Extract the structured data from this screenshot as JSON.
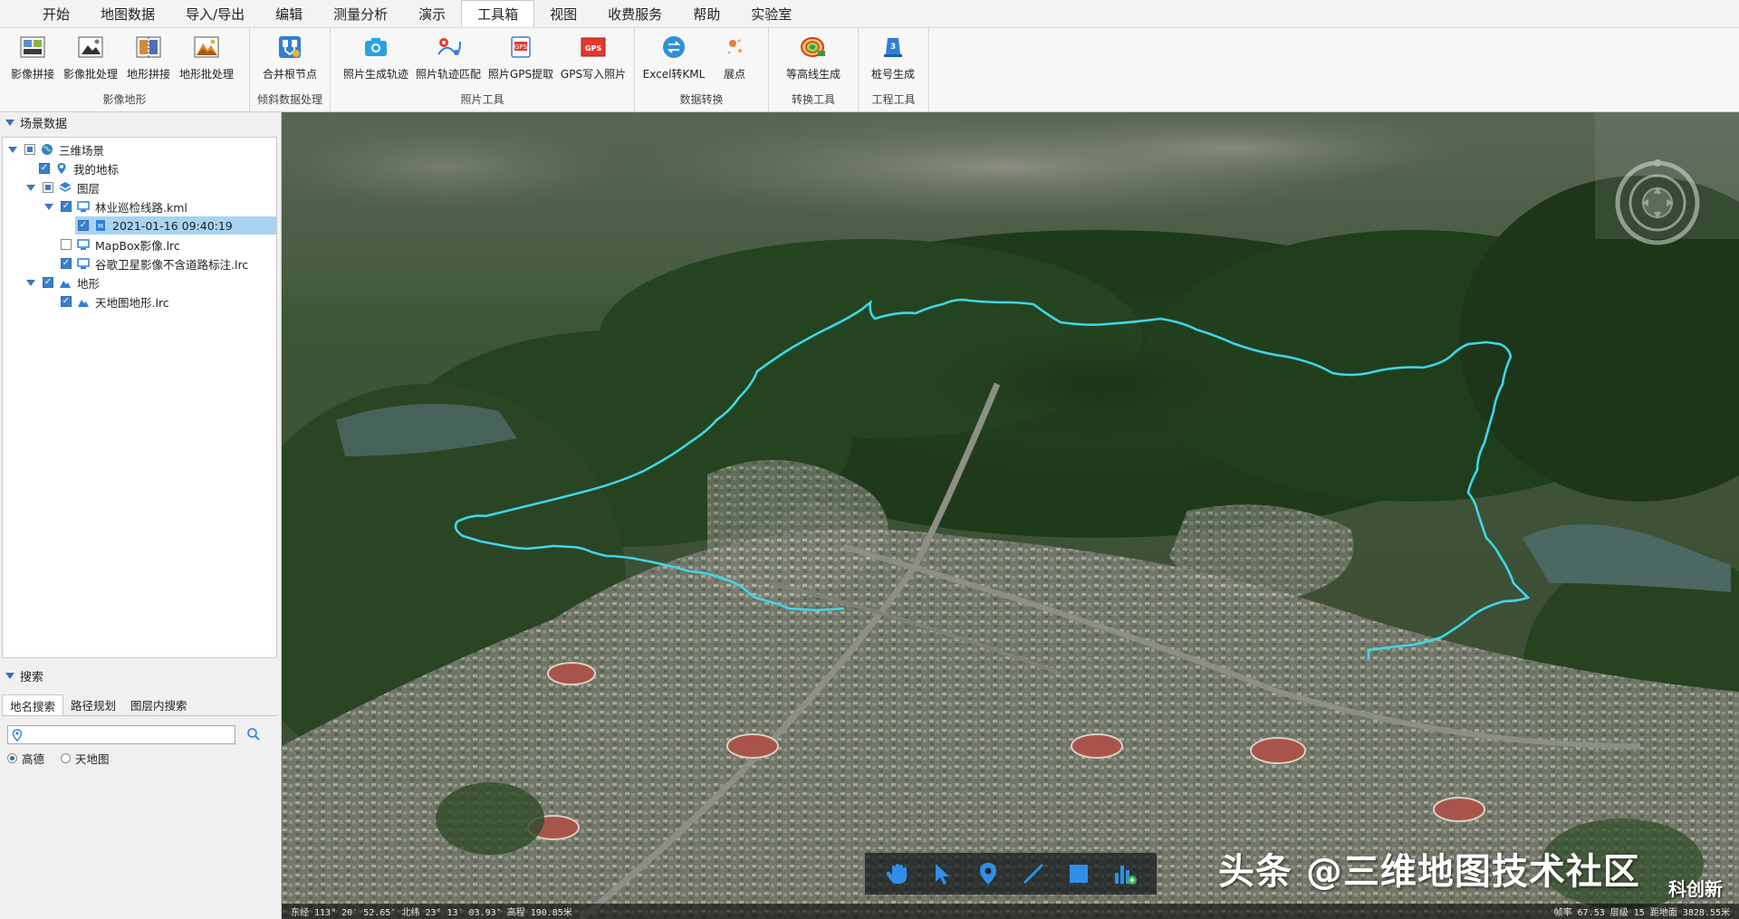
{
  "menu": {
    "tabs": [
      "开始",
      "地图数据",
      "导入/导出",
      "编辑",
      "测量分析",
      "演示",
      "工具箱",
      "视图",
      "收费服务",
      "帮助",
      "实验室"
    ],
    "active_index": 6
  },
  "ribbon": {
    "groups": [
      {
        "label": "影像地形",
        "tools": [
          {
            "label": "影像拼接",
            "icon": "image-mosaic-icon"
          },
          {
            "label": "影像批处理",
            "icon": "image-batch-icon"
          },
          {
            "label": "地形拼接",
            "icon": "terrain-mosaic-icon"
          },
          {
            "label": "地形批处理",
            "icon": "terrain-batch-icon"
          }
        ]
      },
      {
        "label": "倾斜数据处理",
        "tools": [
          {
            "label": "合并根节点",
            "icon": "merge-root-node-icon"
          }
        ]
      },
      {
        "label": "照片工具",
        "tools": [
          {
            "label": "照片生成轨迹",
            "icon": "photo-track-icon"
          },
          {
            "label": "照片轨迹匹配",
            "icon": "photo-track-match-icon"
          },
          {
            "label": "照片GPS提取",
            "icon": "gps-extract-icon"
          },
          {
            "label": "GPS写入照片",
            "icon": "gps-write-icon"
          }
        ]
      },
      {
        "label": "数据转换",
        "tools": [
          {
            "label": "Excel转KML",
            "icon": "excel-kml-icon"
          },
          {
            "label": "展点",
            "icon": "scatter-points-icon"
          }
        ]
      },
      {
        "label": "转换工具",
        "tools": [
          {
            "label": "等高线生成",
            "icon": "contour-icon"
          }
        ]
      },
      {
        "label": "工程工具",
        "tools": [
          {
            "label": "桩号生成",
            "icon": "stake-number-icon"
          }
        ]
      }
    ]
  },
  "scene_panel": {
    "title": "场景数据",
    "tree": {
      "root": "三维场景",
      "my_marks": "我的地标",
      "layers": "图层",
      "kml": "林业巡检线路.kml",
      "kml_child": "2021-01-16 09:40:19",
      "mapbox": "MapBox影像.lrc",
      "google": "谷歌卫星影像不含道路标注.lrc",
      "terrain": "地形",
      "terrain_child": "天地图地形.lrc"
    }
  },
  "search_panel": {
    "title": "搜索",
    "tabs": [
      "地名搜索",
      "路径规划",
      "图层内搜索"
    ],
    "input_value": "",
    "input_placeholder": "",
    "providers": [
      "高德",
      "天地图"
    ],
    "selected_provider": "高德"
  },
  "map": {
    "watermark": "头条 @三维地图技术社区",
    "corner_mark": "科创新",
    "status_left": "东经 113° 20′ 52.65″  北纬 23° 13′ 03.93″  高程 190.85米",
    "status_right": "帧率 67.53  层级 15  距地面 3828.55米",
    "track_color": "#3fd6e8",
    "bottom_tools": [
      "pan-hand-icon",
      "select-arrow-icon",
      "place-mark-icon",
      "draw-line-icon",
      "draw-polygon-icon",
      "chart-add-icon"
    ]
  }
}
